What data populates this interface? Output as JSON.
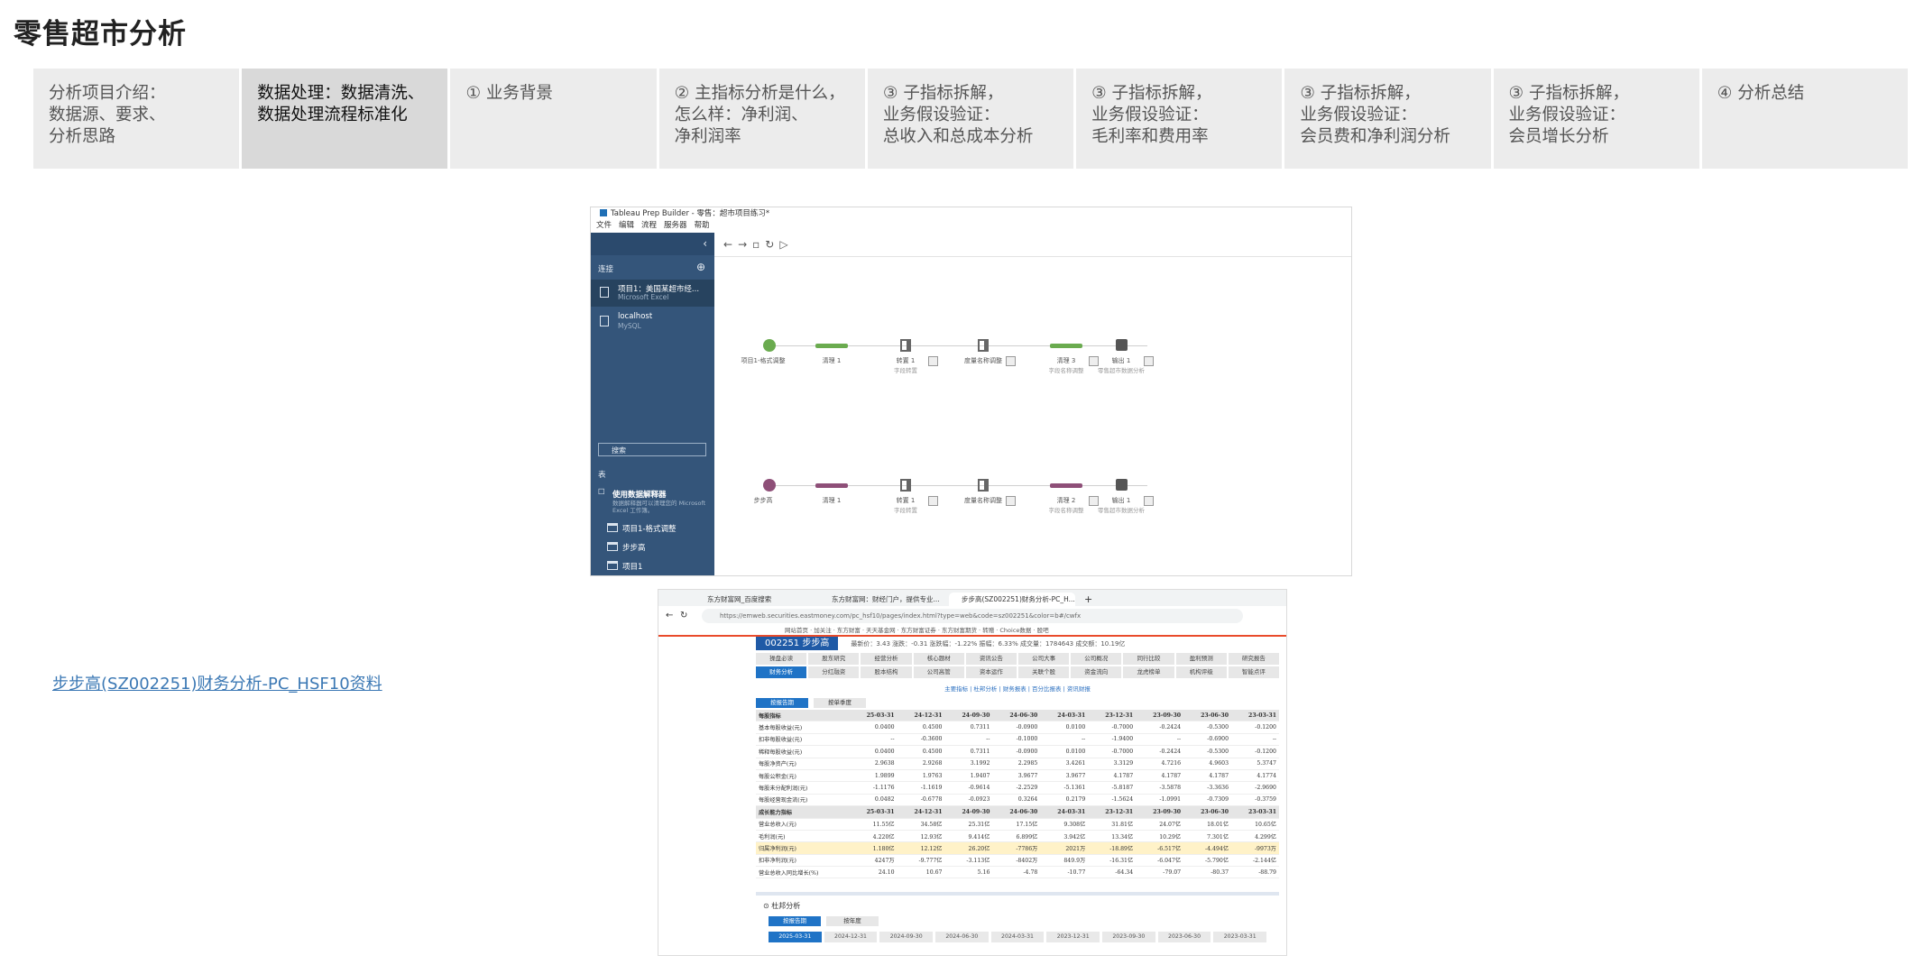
{
  "page": {
    "title": "零售超市分析",
    "link_text": "步步高(SZ002251)财务分析-PC_HSF10资料"
  },
  "tabs": [
    {
      "lines": [
        "分析项目介绍：",
        "数据源、要求、",
        "分析思路"
      ],
      "active": false
    },
    {
      "lines": [
        "数据处理：数据清洗、",
        "数据处理流程标准化"
      ],
      "active": true
    },
    {
      "lines": [
        "① 业务背景"
      ],
      "active": false
    },
    {
      "lines": [
        "② 主指标分析是什么，",
        "怎么样：净利润、",
        "净利润率"
      ],
      "active": false
    },
    {
      "lines": [
        "③ 子指标拆解，",
        "业务假设验证：",
        "总收入和总成本分析"
      ],
      "active": false
    },
    {
      "lines": [
        "③ 子指标拆解，",
        "业务假设验证：",
        "毛利率和费用率"
      ],
      "active": false
    },
    {
      "lines": [
        "③ 子指标拆解，",
        "业务假设验证：",
        "会员费和净利润分析"
      ],
      "active": false
    },
    {
      "lines": [
        "③ 子指标拆解，",
        "业务假设验证：",
        "会员增长分析"
      ],
      "active": false
    },
    {
      "lines": [
        "④ 分析总结"
      ],
      "active": false
    }
  ],
  "prep": {
    "window_title": "Tableau Prep Builder - 零售：超市项目练习*",
    "menus": [
      "文件",
      "编辑",
      "流程",
      "服务器",
      "帮助"
    ],
    "connections_label": "连接",
    "sources": [
      {
        "name": "项目1：美国某超市经...",
        "type": "Microsoft Excel"
      },
      {
        "name": "localhost",
        "type": "MySQL"
      }
    ],
    "search_placeholder": "搜索",
    "tables_label": "表",
    "interpreter_label": "使用数据解释器",
    "interpreter_desc": "数据解释器可以清理您的 Microsoft Excel 工作簿。",
    "tables": [
      "项目1-格式调整",
      "步步高",
      "项目1"
    ],
    "flow1": {
      "input": "项目1-格式调整",
      "steps": [
        "清理 1",
        "转置 1",
        "度量名称调整",
        "清理 3",
        "输出 1"
      ],
      "subs": [
        "字段转置",
        "",
        "字段名称调整",
        "零售超市数据分析"
      ],
      "color": "#6aab4f"
    },
    "flow2": {
      "input": "步步高",
      "steps": [
        "清理 1",
        "转置 1",
        "度量名称调整",
        "清理 2",
        "输出 1"
      ],
      "subs": [
        "字段转置",
        "",
        "字段名称调整",
        "零售超市数据分析"
      ],
      "color": "#8e4f78"
    }
  },
  "browser": {
    "tabs": [
      "东方财富网_百度搜索",
      "东方财富网：财经门户，提供专业...",
      "步步高(SZ002251)财务分析-PC_H..."
    ],
    "url": "https://emweb.securities.eastmoney.com/pc_hsf10/pages/index.html?type=web&code=sz002251&color=b#/cwfx",
    "stock": "002251 步步高",
    "quote": "最新价：3.43  涨跌：-0.31  涨跌幅：-1.22%  振幅：6.33%  成交量：1784643  成交额：10.19亿",
    "nav": [
      "操盘必读",
      "股东研究",
      "经营分析",
      "核心题材",
      "资讯公告",
      "公司大事",
      "公司概况",
      "同行比较",
      "盈利预测",
      "研究报告",
      "财务分析",
      "分红融资",
      "股本结构",
      "公司高管",
      "资本运作",
      "关联个股",
      "资金流向",
      "龙虎榜单",
      "机构评级",
      "智能点评"
    ],
    "section_links": "主要指标 | 杜邦分析 | 财务报表 | 百分比报表 | 资讯财报",
    "period_buttons": [
      "按报告期",
      "按单季度"
    ],
    "table_header": [
      "每股指标",
      "25-03-31",
      "24-12-31",
      "24-09-30",
      "24-06-30",
      "24-03-31",
      "23-12-31",
      "23-09-30",
      "23-06-30",
      "23-03-31"
    ],
    "rows": [
      [
        "基本每股收益(元)",
        "0.0400",
        "0.4500",
        "0.7311",
        "-0.0900",
        "0.0100",
        "-0.7000",
        "-0.2424",
        "-0.5300",
        "-0.1200"
      ],
      [
        "扣非每股收益(元)",
        "--",
        "-0.3600",
        "--",
        "-0.1000",
        "--",
        "-1.9400",
        "--",
        "-0.6900",
        "--"
      ],
      [
        "稀释每股收益(元)",
        "0.0400",
        "0.4500",
        "0.7311",
        "-0.0900",
        "0.0100",
        "-0.7000",
        "-0.2424",
        "-0.5300",
        "-0.1200"
      ],
      [
        "每股净资产(元)",
        "2.9638",
        "2.9268",
        "3.1992",
        "2.2985",
        "3.4261",
        "3.3129",
        "4.7216",
        "4.9603",
        "5.3747"
      ],
      [
        "每股公积金(元)",
        "1.9899",
        "1.9763",
        "1.9407",
        "3.9677",
        "3.9677",
        "4.1787",
        "4.1787",
        "4.1787",
        "4.1774"
      ],
      [
        "每股未分配利润(元)",
        "-1.1176",
        "-1.1619",
        "-0.9614",
        "-2.2529",
        "-5.1361",
        "-5.8187",
        "-3.5878",
        "-3.3636",
        "-2.9690"
      ],
      [
        "每股经营现金流(元)",
        "0.0482",
        "-0.6778",
        "-0.0923",
        "0.3264",
        "0.2179",
        "-1.5624",
        "-1.0991",
        "-0.7309",
        "-0.3759"
      ]
    ],
    "table_header2": [
      "成长能力指标",
      "25-03-31",
      "24-12-31",
      "24-09-30",
      "24-06-30",
      "24-03-31",
      "23-12-31",
      "23-09-30",
      "23-06-30",
      "23-03-31"
    ],
    "rows2": [
      [
        "营业总收入(元)",
        "11.55亿",
        "34.58亿",
        "25.31亿",
        "17.15亿",
        "9.308亿",
        "31.81亿",
        "24.07亿",
        "18.01亿",
        "10.65亿"
      ],
      [
        "毛利润(元)",
        "4.220亿",
        "12.93亿",
        "9.414亿",
        "6.899亿",
        "3.942亿",
        "13.34亿",
        "10.29亿",
        "7.301亿",
        "4.299亿"
      ],
      [
        "归属净利润(元)",
        "1.180亿",
        "12.12亿",
        "26.20亿",
        "-7786万",
        "2021万",
        "-18.89亿",
        "-6.517亿",
        "-4.494亿",
        "-9973万"
      ],
      [
        "扣非净利润(元)",
        "4247万",
        "-9.777亿",
        "-3.113亿",
        "-8402万",
        "849.9万",
        "-16.31亿",
        "-6.047亿",
        "-5.790亿",
        "-2.144亿"
      ],
      [
        "营业总收入同比增长(%)",
        "24.10",
        "10.67",
        "5.16",
        "-4.78",
        "-10.77",
        "-64.34",
        "-79.07",
        "-80.37",
        "-88.79"
      ]
    ],
    "highlight_row": 2,
    "dupont_title": "杜邦分析",
    "dupont_buttons": [
      "按报告期",
      "按年度"
    ],
    "dupont_dates": [
      "2025-03-31",
      "2024-12-31",
      "2024-09-30",
      "2024-06-30",
      "2024-03-31",
      "2023-12-31",
      "2023-09-30",
      "2023-06-30",
      "2023-03-31"
    ]
  }
}
